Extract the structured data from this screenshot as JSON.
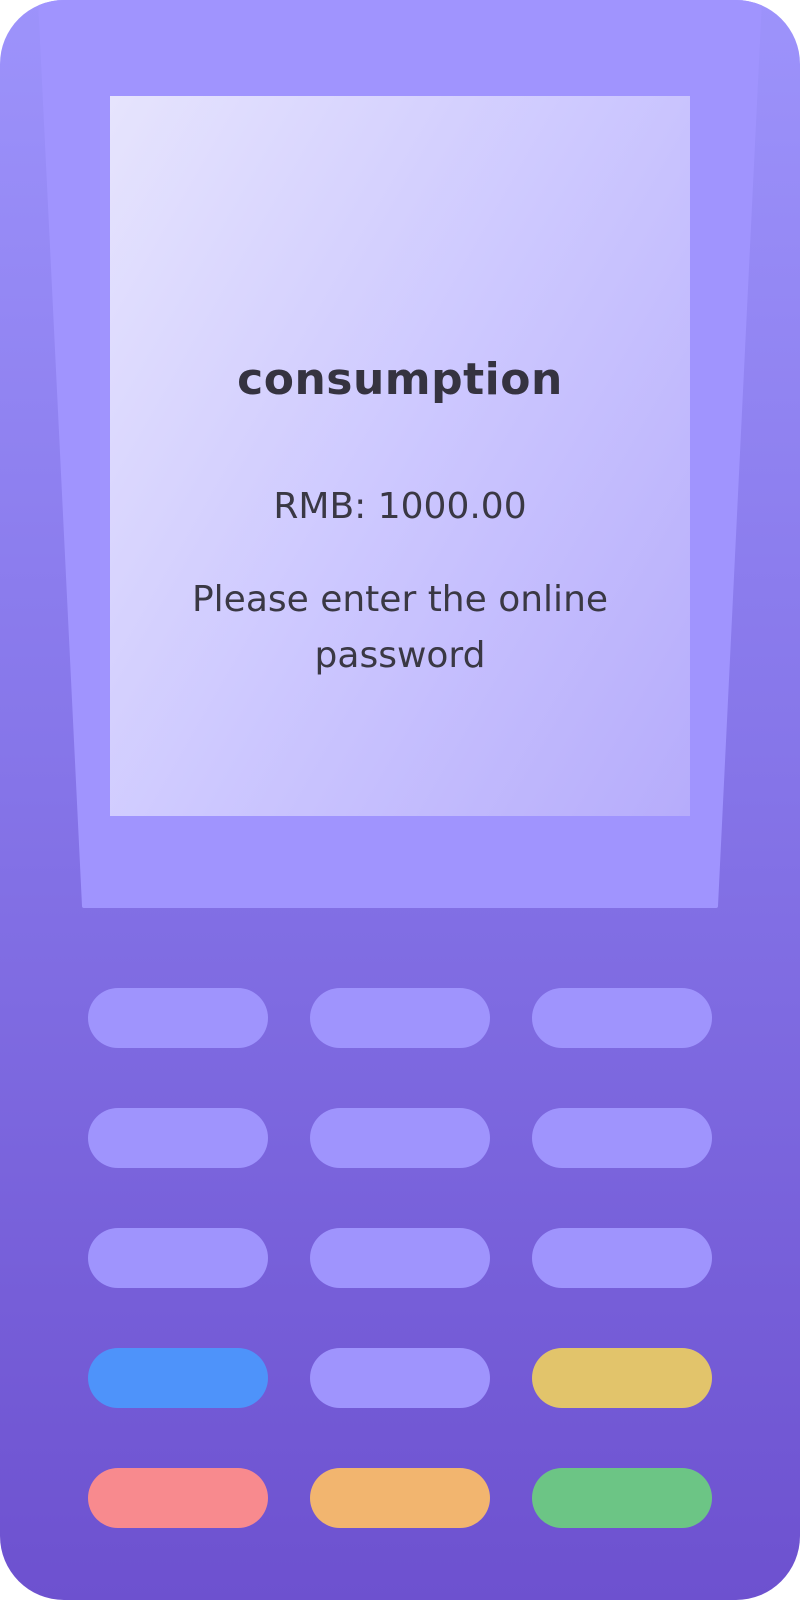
{
  "screen": {
    "title": "consumption",
    "amount": "RMB: 1000.00",
    "prompt": "Please enter the online password"
  },
  "colors": {
    "body_top": "#9d93fb",
    "body_bottom": "#6d51cf",
    "bezel": "#a094fe",
    "key_default": "#9f94fd",
    "key_blue": "#4e93fa",
    "key_yellow": "#e2c46b",
    "key_red": "#f88a8e",
    "key_orange": "#f2b56f",
    "key_green": "#6cc585"
  },
  "keypad": {
    "rows": [
      [
        "default",
        "default",
        "default"
      ],
      [
        "default",
        "default",
        "default"
      ],
      [
        "default",
        "default",
        "default"
      ],
      [
        "blue",
        "default",
        "yellow"
      ],
      [
        "red",
        "orange",
        "green"
      ]
    ]
  }
}
